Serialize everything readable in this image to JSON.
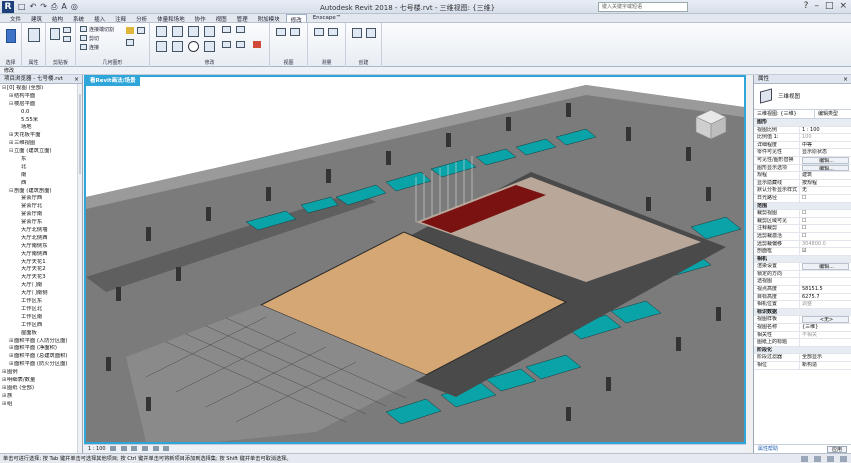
{
  "titlebar": {
    "logo": "R",
    "title": "Autodesk Revit 2018 - 七号楼.rvt - 三维视图: {三维}",
    "search_placeholder": "键入关键字或短语",
    "qat": [
      "□",
      "↶",
      "↷",
      "⎙",
      "A",
      "◎"
    ]
  },
  "tabs": [
    "文件",
    "建筑",
    "结构",
    "系统",
    "插入",
    "注释",
    "分析",
    "体量和场地",
    "协作",
    "视图",
    "管理",
    "附加模块",
    "修改",
    "Enscape™"
  ],
  "active_tab_index": 12,
  "ribbon": {
    "groups": [
      "选择",
      "属性",
      "剪贴板",
      "几何图形",
      "修改",
      "视图",
      "测量",
      "创建"
    ],
    "clipboard_items": [
      "连接端切割",
      "剪切",
      "连接"
    ],
    "modify_label": "修改"
  },
  "optbar": {
    "text": "修改"
  },
  "browser": {
    "header": "项目浏览器 - 七号楼.rvt",
    "rows": [
      {
        "indent": 0,
        "tw": "⊟",
        "label": "[0] 视图 (全部)"
      },
      {
        "indent": 1,
        "tw": "⊞",
        "label": "结构平面"
      },
      {
        "indent": 1,
        "tw": "⊟",
        "label": "楼层平面"
      },
      {
        "indent": 2,
        "tw": "",
        "label": "0.0"
      },
      {
        "indent": 2,
        "tw": "",
        "label": "5.55米"
      },
      {
        "indent": 2,
        "tw": "",
        "label": "场地"
      },
      {
        "indent": 1,
        "tw": "⊞",
        "label": "天花板平面"
      },
      {
        "indent": 1,
        "tw": "⊞",
        "label": "三维视图"
      },
      {
        "indent": 1,
        "tw": "⊟",
        "label": "立面 (建筑立面)"
      },
      {
        "indent": 2,
        "tw": "",
        "label": "东"
      },
      {
        "indent": 2,
        "tw": "",
        "label": "北"
      },
      {
        "indent": 2,
        "tw": "",
        "label": "南"
      },
      {
        "indent": 2,
        "tw": "",
        "label": "西"
      },
      {
        "indent": 1,
        "tw": "⊟",
        "label": "剖面 (建筑剖面)"
      },
      {
        "indent": 2,
        "tw": "",
        "label": "宴会厅西"
      },
      {
        "indent": 2,
        "tw": "",
        "label": "宴会厅北"
      },
      {
        "indent": 2,
        "tw": "",
        "label": "宴会厅南"
      },
      {
        "indent": 2,
        "tw": "",
        "label": "宴会厅东"
      },
      {
        "indent": 2,
        "tw": "",
        "label": "大厅北侧墙"
      },
      {
        "indent": 2,
        "tw": "",
        "label": "大厅北侧西"
      },
      {
        "indent": 2,
        "tw": "",
        "label": "大厅南侧东"
      },
      {
        "indent": 2,
        "tw": "",
        "label": "大厅南侧西"
      },
      {
        "indent": 2,
        "tw": "",
        "label": "大厅天花1"
      },
      {
        "indent": 2,
        "tw": "",
        "label": "大厅天花2"
      },
      {
        "indent": 2,
        "tw": "",
        "label": "大厅天花3"
      },
      {
        "indent": 2,
        "tw": "",
        "label": "大厅门南"
      },
      {
        "indent": 2,
        "tw": "",
        "label": "大厅门南侧"
      },
      {
        "indent": 2,
        "tw": "",
        "label": "工作区东"
      },
      {
        "indent": 2,
        "tw": "",
        "label": "工作区北"
      },
      {
        "indent": 2,
        "tw": "",
        "label": "工作区南"
      },
      {
        "indent": 2,
        "tw": "",
        "label": "工作区西"
      },
      {
        "indent": 2,
        "tw": "",
        "label": "屋面板"
      },
      {
        "indent": 1,
        "tw": "⊞",
        "label": "面积平面 (人防分区面)"
      },
      {
        "indent": 1,
        "tw": "⊞",
        "label": "面积平面 (净面积)"
      },
      {
        "indent": 1,
        "tw": "⊞",
        "label": "面积平面 (总建筑面积)"
      },
      {
        "indent": 1,
        "tw": "⊞",
        "label": "面积平面 (防火分区面)"
      },
      {
        "indent": 0,
        "tw": "⊞",
        "label": "图例"
      },
      {
        "indent": 0,
        "tw": "⊞",
        "label": "明细表/数量"
      },
      {
        "indent": 0,
        "tw": "⊞",
        "label": "图纸 (全部)"
      },
      {
        "indent": 0,
        "tw": "⊞",
        "label": "族"
      },
      {
        "indent": 0,
        "tw": "⊞",
        "label": "组"
      }
    ]
  },
  "viewport": {
    "tab": "看Revit画法/场景"
  },
  "viewbar": {
    "scale": "1 : 100"
  },
  "props": {
    "header": "属性",
    "type_name": "三维视图",
    "selector": "三维视图: {三维}",
    "edit_type": "编辑类型",
    "rows": [
      {
        "type": "group",
        "k": "图形"
      },
      {
        "k": "视图比例",
        "v": "1 : 100"
      },
      {
        "k": "比例值 1:",
        "v": "100",
        "dim": true
      },
      {
        "k": "详细程度",
        "v": "中等"
      },
      {
        "k": "零件可见性",
        "v": "显示原状态"
      },
      {
        "k": "可见性/图形替换",
        "v": "编辑...",
        "btn": true
      },
      {
        "k": "图形显示选项",
        "v": "编辑...",
        "btn": true
      },
      {
        "k": "规程",
        "v": "建筑"
      },
      {
        "k": "显示隐藏线",
        "v": "按规程"
      },
      {
        "k": "默认分析显示样式",
        "v": "无"
      },
      {
        "k": "日光路径",
        "v": "☐"
      },
      {
        "type": "group",
        "k": "范围"
      },
      {
        "k": "裁剪视图",
        "v": "☐"
      },
      {
        "k": "裁剪区域可见",
        "v": "☐"
      },
      {
        "k": "注释裁剪",
        "v": "☐"
      },
      {
        "k": "远剪裁激活",
        "v": "☐"
      },
      {
        "k": "远剪裁偏移",
        "v": "304800.0",
        "dim": true
      },
      {
        "k": "剖面框",
        "v": "☑"
      },
      {
        "type": "group",
        "k": "相机"
      },
      {
        "k": "渲染设置",
        "v": "编辑...",
        "btn": true
      },
      {
        "k": "锁定的方向",
        "v": "",
        "dim": true
      },
      {
        "k": "透视图",
        "v": "",
        "dim": true
      },
      {
        "k": "视点高度",
        "v": "58151.5"
      },
      {
        "k": "目标高度",
        "v": "6275.7"
      },
      {
        "k": "相机位置",
        "v": "调整",
        "dim": true
      },
      {
        "type": "group",
        "k": "标识数据"
      },
      {
        "k": "视图样板",
        "v": "<无>",
        "btn": true
      },
      {
        "k": "视图名称",
        "v": "{三维}"
      },
      {
        "k": "相关性",
        "v": "不相关",
        "dim": true
      },
      {
        "k": "图纸上的标题",
        "v": ""
      },
      {
        "type": "group",
        "k": "阶段化"
      },
      {
        "k": "阶段过滤器",
        "v": "全部显示"
      },
      {
        "k": "相位",
        "v": "新构造"
      }
    ],
    "help_link": "属性帮助",
    "apply": "应用"
  },
  "statusbar": {
    "text": "单击可进行选择; 按 Tab 键并单击可选择其他项目; 按 Ctrl 键并单击可将新项目添加到选择集; 按 Shift 键并单击可取消选择。"
  },
  "colors": {
    "accent": "#2fa6d9",
    "floor": "#d4a774",
    "stage": "#7a1212",
    "room_fill": "#0aa3a8",
    "model_gray": "#6f6f6f"
  }
}
